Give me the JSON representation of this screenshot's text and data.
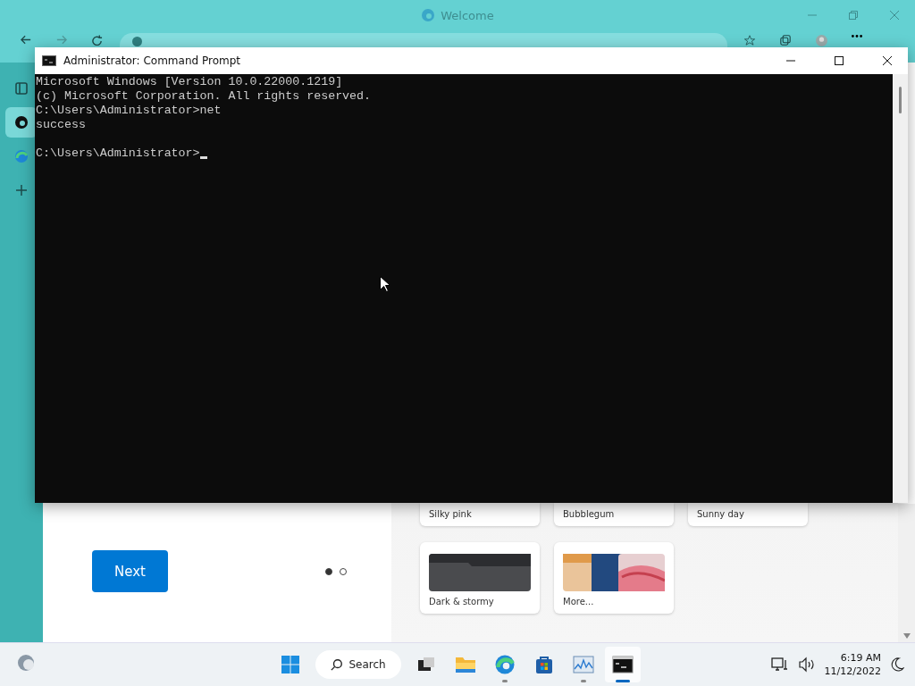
{
  "browser": {
    "title": "Welcome",
    "sidebar": [
      {
        "kind": "tabs",
        "selected": false
      },
      {
        "kind": "edge-dark",
        "selected": true
      },
      {
        "kind": "edge",
        "selected": false
      },
      {
        "kind": "add",
        "selected": false
      }
    ],
    "welcome": {
      "next_button": "Next",
      "pager": [
        {
          "selected": true
        },
        {
          "selected": false
        }
      ],
      "themes": [
        {
          "label": "Silky pink",
          "kind": "hidden"
        },
        {
          "label": "Bubblegum",
          "kind": "hidden"
        },
        {
          "label": "Sunny day",
          "kind": "hidden"
        },
        {
          "label": "Dark & stormy",
          "kind": "dark"
        },
        {
          "label": "More...",
          "kind": "more"
        }
      ]
    }
  },
  "command_prompt": {
    "title": "Administrator: Command Prompt",
    "blocks": [
      {
        "lines": [
          "Microsoft Windows [Version 10.0.22000.1219]",
          "(c) Microsoft Corporation. All rights reserved.",
          "C:\\Users\\Administrator>net",
          "success"
        ],
        "cursor": false
      },
      {
        "lines": [
          "C:\\Users\\Administrator>"
        ],
        "cursor": true
      }
    ]
  },
  "taskbar": {
    "search": "Search",
    "apps": [
      {
        "kind": "taskview",
        "running": false,
        "active": false
      },
      {
        "kind": "explorer",
        "running": false,
        "active": false
      },
      {
        "kind": "edge",
        "running": true,
        "active": false
      },
      {
        "kind": "store",
        "running": false,
        "active": false
      },
      {
        "kind": "taskmanager",
        "running": true,
        "active": false
      },
      {
        "kind": "terminal",
        "running": true,
        "active": true
      }
    ],
    "time": "6:19 AM",
    "date": "11/12/2022"
  }
}
